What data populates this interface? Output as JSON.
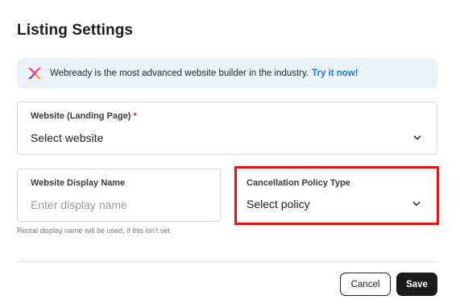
{
  "header": {
    "title": "Listing Settings"
  },
  "banner": {
    "text": "Webready is the most advanced website builder in the industry.",
    "link": "Try it now!",
    "logo_icon": "webready-logo-icon"
  },
  "website_field": {
    "label": "Website (Landing Page)",
    "required_mark": "*",
    "value": "Select website"
  },
  "display_name_field": {
    "label": "Website Display Name",
    "placeholder": "Enter display name",
    "helper": "Rental display name will be used, if this isn't set"
  },
  "policy_field": {
    "label": "Cancellation Policy Type",
    "value": "Select policy"
  },
  "footer": {
    "cancel_label": "Cancel",
    "save_label": "Save"
  },
  "colors": {
    "accent_link": "#1c7bd6",
    "highlight": "#e01414",
    "required": "#d12b2b",
    "primary_button": "#1b1b1b"
  }
}
